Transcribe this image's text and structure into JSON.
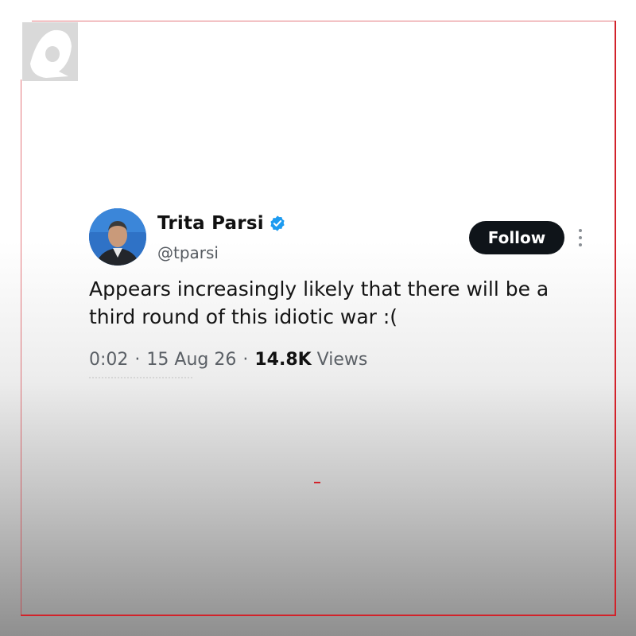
{
  "tweet": {
    "author_name": "Trita Parsi",
    "handle": "@tparsi",
    "follow_label": "Follow",
    "text": "Appears increasingly likely that there will be a third round of this idiotic war :(",
    "time": "0:02",
    "separator": "·",
    "date": "15 Aug 26",
    "views_count": "14.8K",
    "views_label": "Views"
  },
  "icons": {
    "logo": "channel-logo-icon",
    "verified": "verified-badge-icon",
    "more": "more-options-icon"
  },
  "colors": {
    "accent_red": "#d2222a",
    "verified_blue": "#1d9bf0",
    "follow_bg": "#0f1419"
  }
}
